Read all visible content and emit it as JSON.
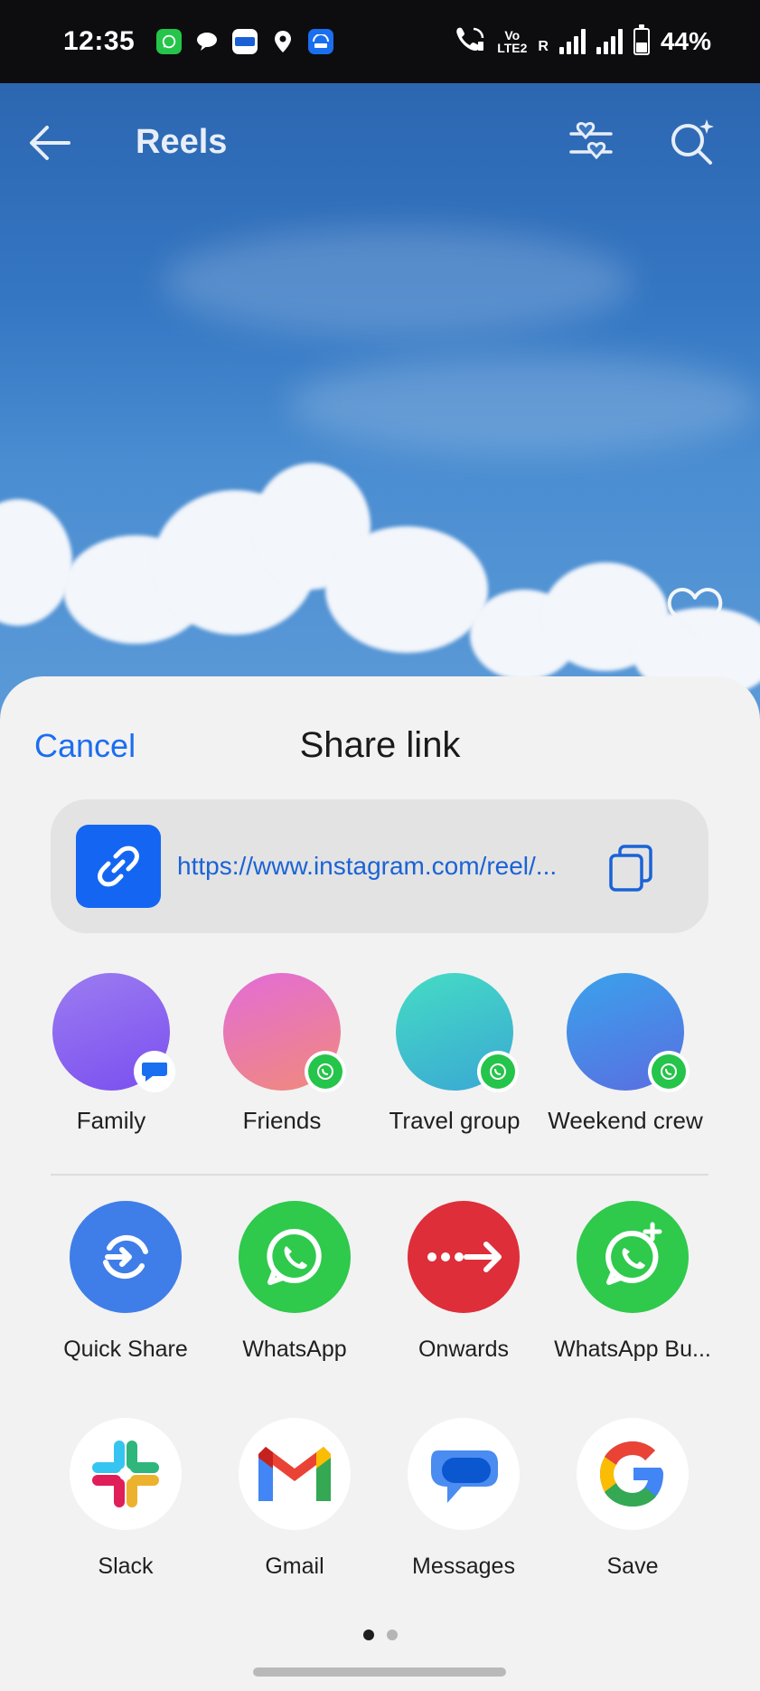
{
  "status_bar": {
    "time": "12:35",
    "volte": "Vo",
    "lte": "LTE2",
    "roaming": "R",
    "battery": "44%",
    "battery_level": 0.44,
    "icons": [
      "whatsapp-notification-icon",
      "chat-notification-icon",
      "paytm-notification-icon",
      "location-icon",
      "hotspot-icon",
      "wifi-calling-icon",
      "signal-icon",
      "battery-icon"
    ]
  },
  "header": {
    "title": "Reels",
    "icons": [
      "back-arrow-icon",
      "filter-heart-icon",
      "search-sparkle-icon",
      "heart-icon"
    ]
  },
  "sheet": {
    "cancel_label": "Cancel",
    "title": "Share link",
    "link_url": "https://www.instagram.com/reel/...",
    "link_icon": "link-icon",
    "copy_icon": "copy-icon"
  },
  "contacts": [
    {
      "label": "Family",
      "badge": "messages-badge-icon",
      "color_from": "#9b7cf0",
      "color_to": "#7b4ff0"
    },
    {
      "label": "Friends",
      "badge": "whatsapp-badge-icon",
      "color_from": "#e36cd8",
      "color_to": "#f08a7a"
    },
    {
      "label": "Travel group",
      "badge": "whatsapp-badge-icon",
      "color_from": "#45dcc4",
      "color_to": "#3aa8d4"
    },
    {
      "label": "Weekend crew",
      "badge": "whatsapp-badge-icon",
      "color_from": "#3aa2ec",
      "color_to": "#5a6ee0"
    }
  ],
  "apps_row1": [
    {
      "label": "Quick Share",
      "icon": "quick-share-icon",
      "color": "#3f7ee8"
    },
    {
      "label": "WhatsApp",
      "icon": "whatsapp-icon",
      "color": "#2fc94c"
    },
    {
      "label": "Onwards",
      "icon": "onwards-icon",
      "color": "#de2e3a"
    },
    {
      "label": "WhatsApp Bu...",
      "icon": "whatsapp-business-icon",
      "color": "#2fc94c"
    }
  ],
  "apps_row2": [
    {
      "label": "Slack",
      "icon": "slack-icon",
      "color": "#ffffff"
    },
    {
      "label": "Gmail",
      "icon": "gmail-icon",
      "color": "#ffffff"
    },
    {
      "label": "Messages",
      "icon": "messages-icon",
      "color": "#ffffff"
    },
    {
      "label": "Save",
      "icon": "google-icon",
      "color": "#ffffff"
    }
  ],
  "pager": {
    "pages": 2,
    "current": 1
  }
}
